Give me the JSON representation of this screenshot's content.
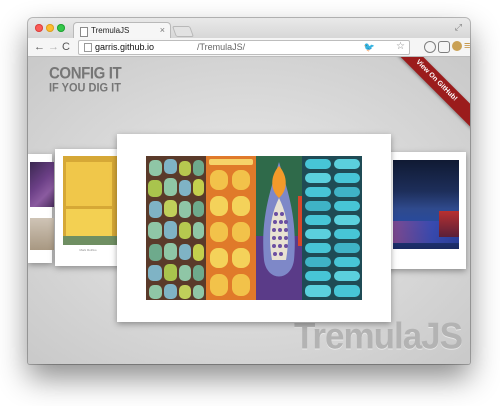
{
  "browser": {
    "tab_title": "TremulaJS",
    "tab_close": "×",
    "url_host": "garris.github.io",
    "url_path": "/TremulaJS/",
    "nav_back": "←",
    "nav_forward": "→",
    "nav_reload": "C",
    "twitter_icon": "🐦",
    "star_icon": "☆",
    "menu_icon": "≡",
    "fullscreen_icon": "⤢"
  },
  "page": {
    "config_title": "CONFIG IT",
    "config_subtitle": "IF YOU DIG IT",
    "ribbon_label": "View On GitHub!",
    "logo": "TremulaJS",
    "caption_b": "Mark Rothko"
  },
  "colors": {
    "ribbon": "#9b1c1c",
    "logo": "#b3b3b3",
    "page_bg": "#d8d8d8"
  }
}
